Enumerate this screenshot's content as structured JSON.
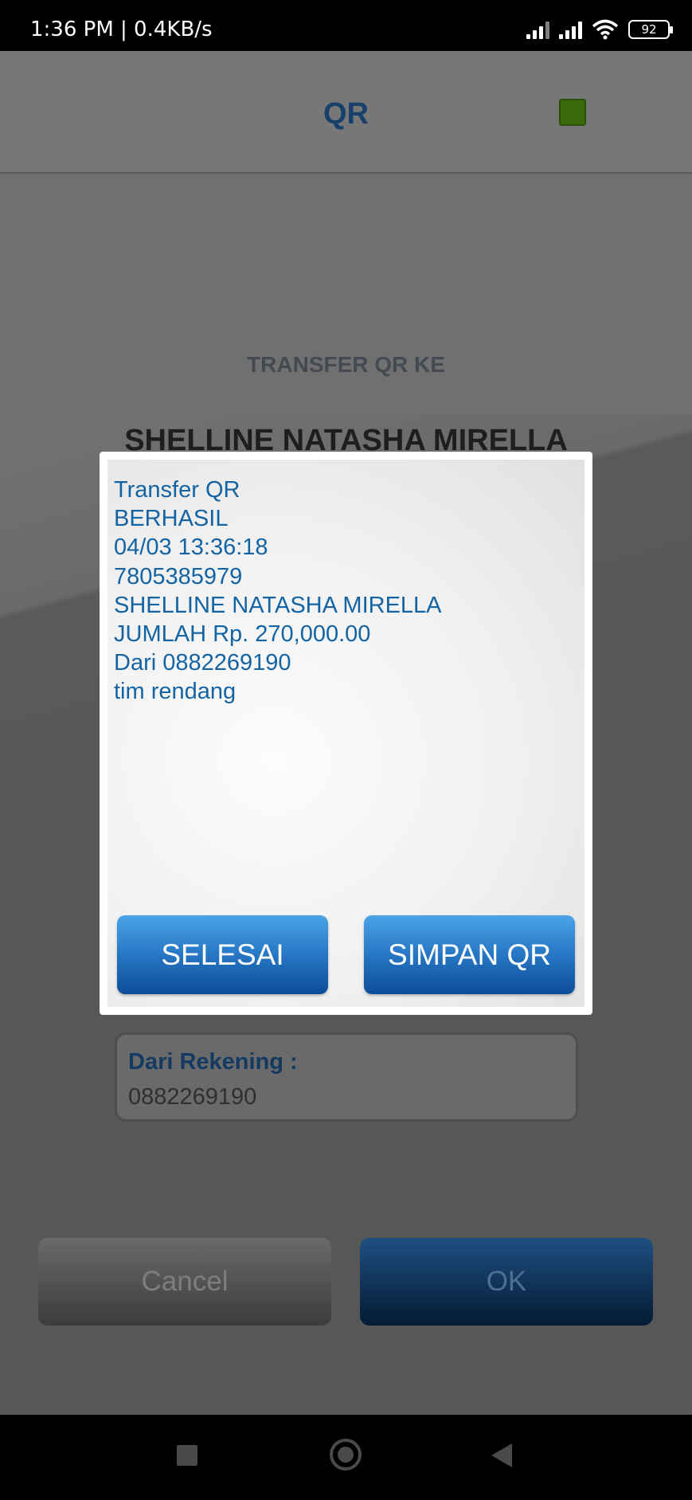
{
  "status_bar": {
    "time": "1:36 PM | 0.4KB/s",
    "battery": "92"
  },
  "header": {
    "title": "QR",
    "indicator_color": "#3b6a0c"
  },
  "screen": {
    "transfer_label": "TRANSFER QR KE",
    "recipient_name": "SHELLINE NATASHA MIRELLA",
    "account_label": "Dari Rekening :",
    "account_value": "0882269190",
    "cancel_label": "Cancel",
    "ok_label": "OK"
  },
  "dialog": {
    "lines": [
      "Transfer QR",
      "BERHASIL",
      "04/03 13:36:18",
      "7805385979",
      "SHELLINE NATASHA MIRELLA",
      "JUMLAH Rp. 270,000.00",
      "Dari 0882269190",
      "tim rendang"
    ],
    "selesai_label": "SELESAI",
    "simpan_label": "SIMPAN QR"
  },
  "colors": {
    "accent": "#1464a4",
    "button_blue": "#2a7bc8",
    "header_title": "#17406a"
  }
}
